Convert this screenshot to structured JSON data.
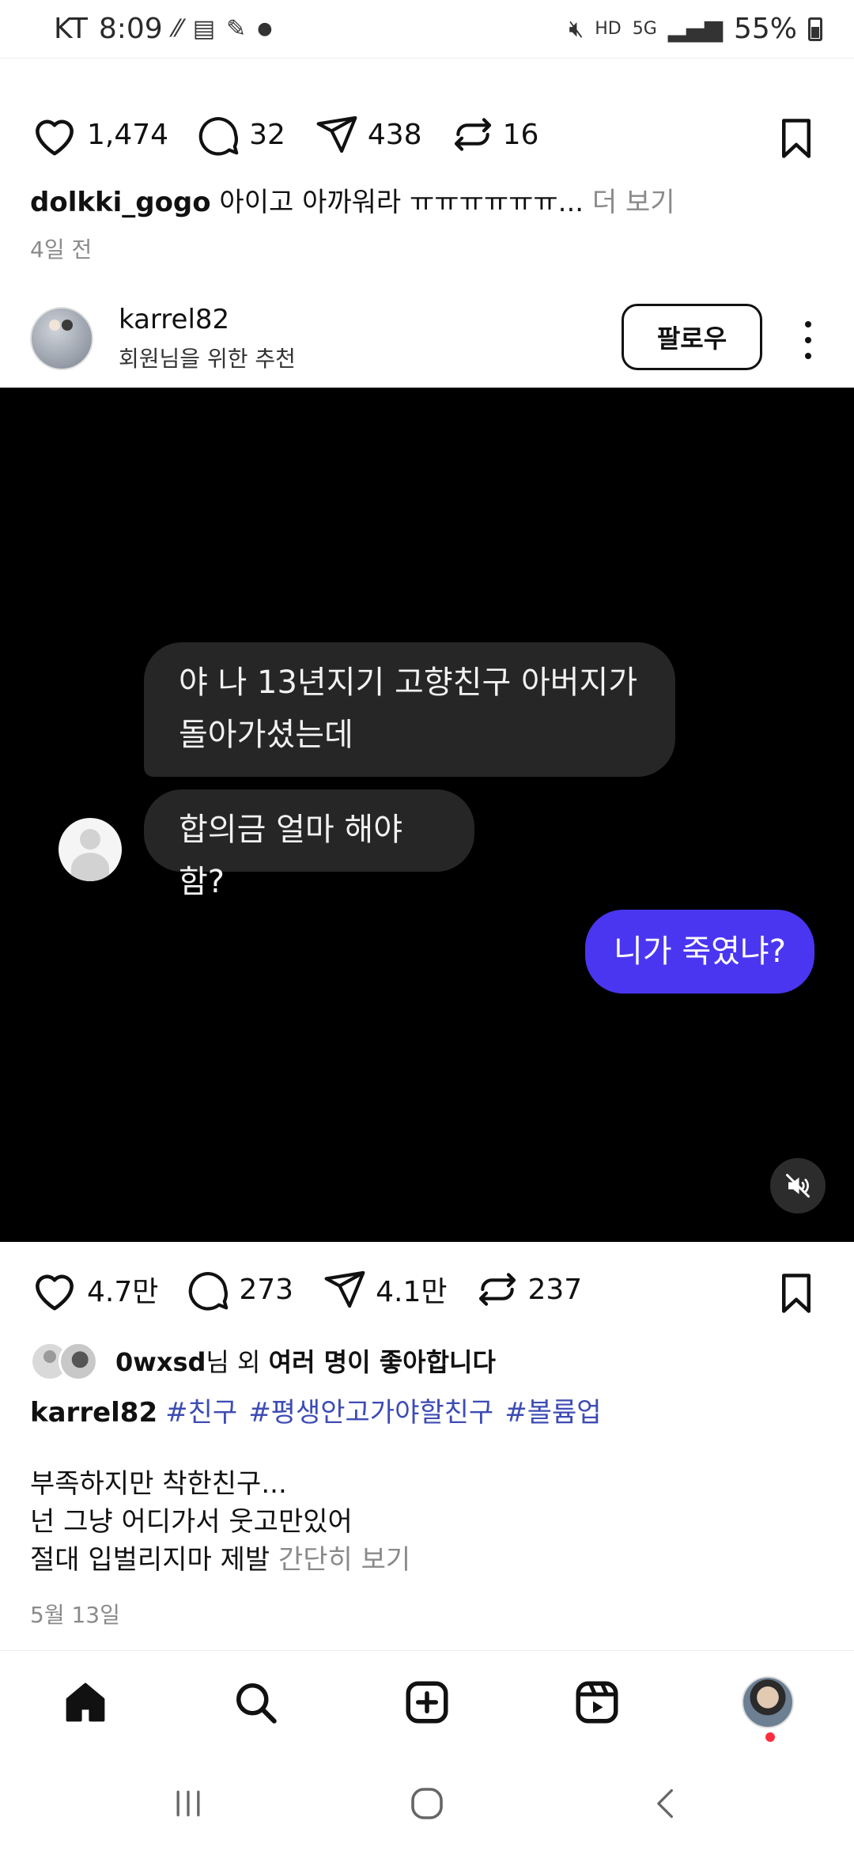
{
  "status_bar": {
    "carrier": "KT",
    "time": "8:09",
    "battery": "55%",
    "network": "5G",
    "hd": "HD"
  },
  "post1": {
    "likes": "1,474",
    "comments": "32",
    "shares": "438",
    "reposts": "16",
    "caption_user": "dolkki_gogo",
    "caption_text": " 아이고 아까워라 ㅠㅠㅠㅠㅠㅠ...",
    "more_label": " 더 보기",
    "date": "4일 전"
  },
  "post2": {
    "username": "karrel82",
    "subtitle": "회원님을 위한 추천",
    "follow_label": "팔로우",
    "chat": {
      "incoming_1_line1": "야 나 13년지기 고향친구 아버지가",
      "incoming_1_line2": "돌아가셨는데",
      "incoming_2": "합의금 얼마 해야함?",
      "outgoing": "니가 죽였냐?"
    },
    "likes": "4.7만",
    "comments": "273",
    "shares": "4.1만",
    "reposts": "237",
    "liked_by_user": "0wxsd",
    "liked_by_mid": "님 외 ",
    "liked_by_rest": "여러 명이 좋아합니다",
    "caption_user": "karrel82",
    "hashtags": [
      "#친구",
      "#평생안고가야할친구",
      "#볼륨업"
    ],
    "body_line1": "부족하지만 착한친구...",
    "body_line2": "넌 그냥 어디가서 웃고만있어",
    "body_line3": "절대 입벌리지마 제발",
    "less_label": " 간단히 보기",
    "date": "5월 13일"
  },
  "colors": {
    "accent_purple": "#4a36f1",
    "hashtag_blue": "#3d4cb4",
    "notif_red": "#ff2d3d"
  },
  "icons": {
    "nav": [
      "home-icon",
      "search-icon",
      "create-icon",
      "reels-icon",
      "profile-avatar"
    ],
    "system": [
      "recents-icon",
      "home-circle-icon",
      "back-icon"
    ]
  }
}
